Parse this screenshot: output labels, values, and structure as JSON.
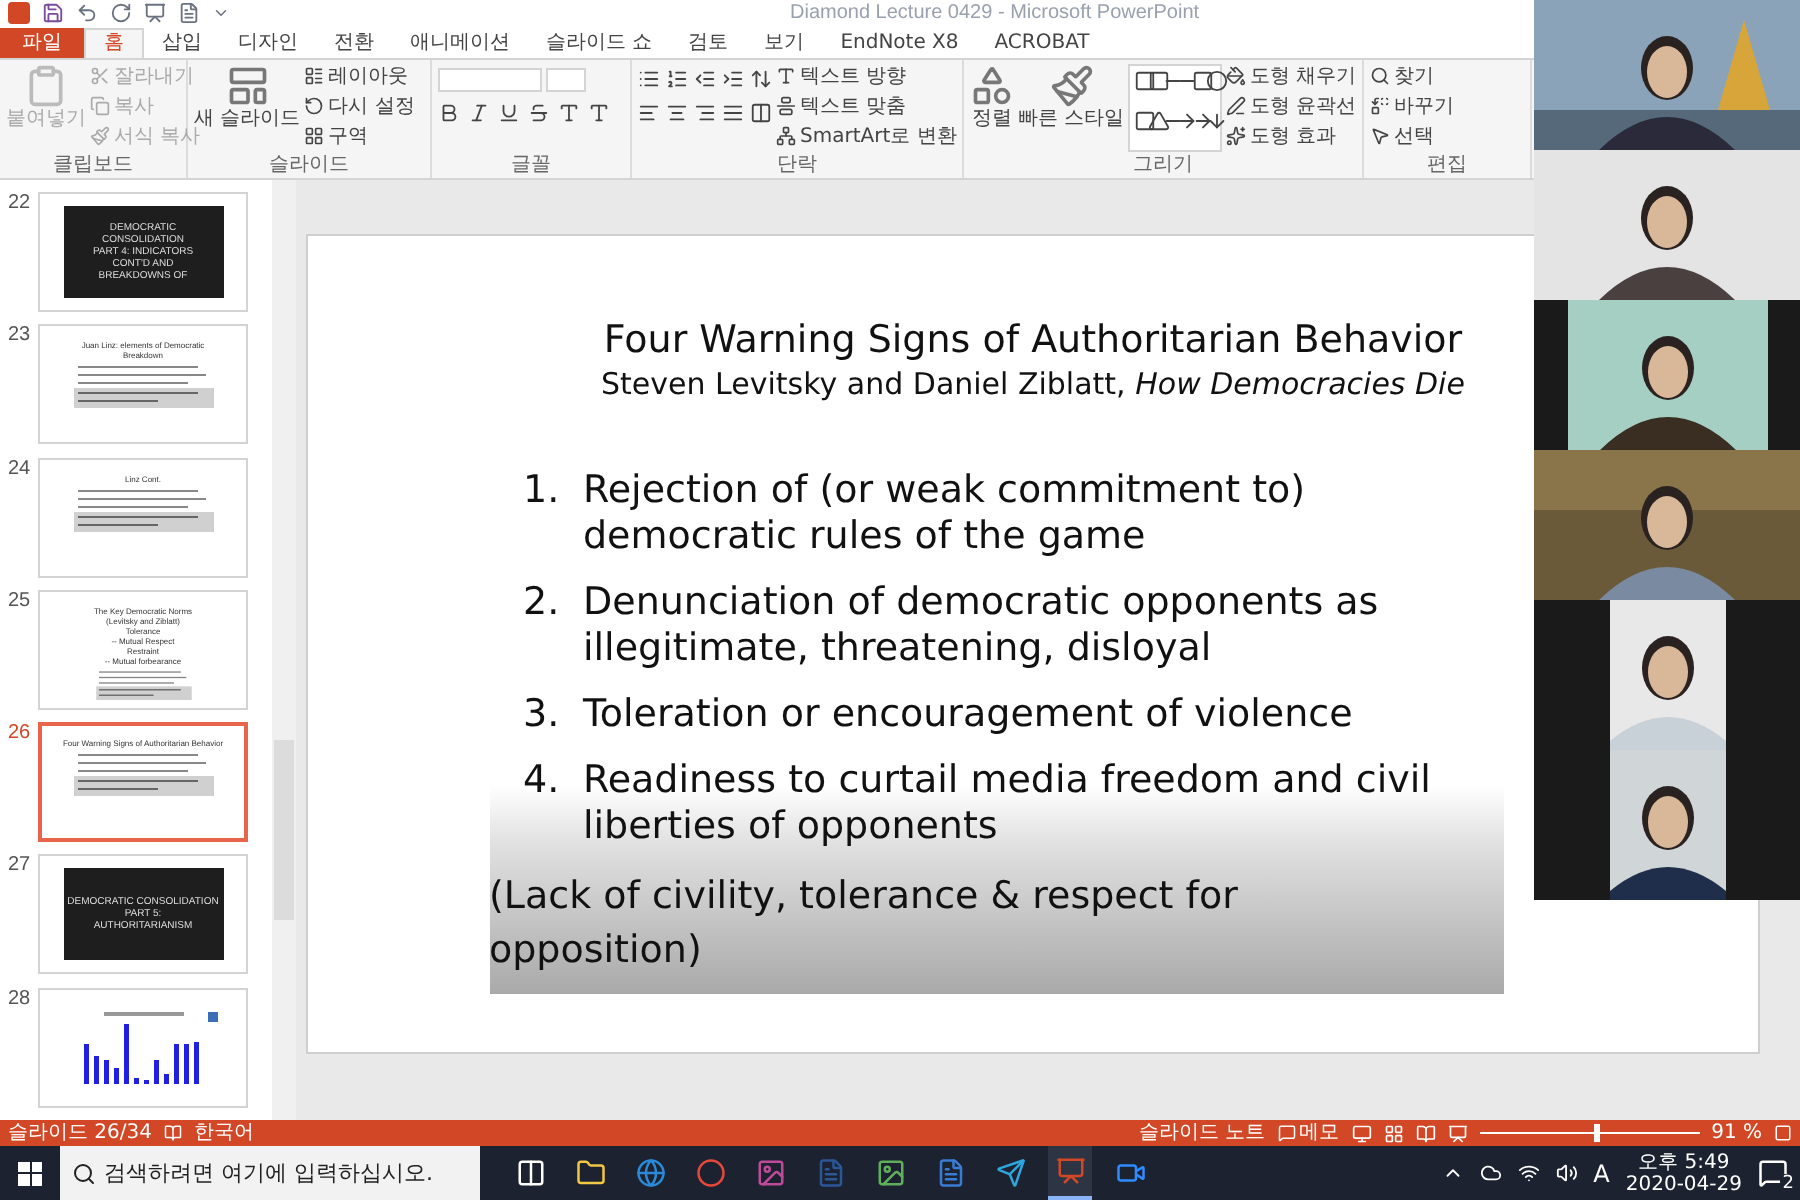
{
  "window": {
    "title": "Diamond Lecture 0429 - Microsoft PowerPoint"
  },
  "ribbon_tabs": [
    {
      "label": "파일",
      "kind": "file",
      "selected": false
    },
    {
      "label": "홈",
      "kind": "tab",
      "selected": true
    },
    {
      "label": "삽입",
      "kind": "tab",
      "selected": false
    },
    {
      "label": "디자인",
      "kind": "tab",
      "selected": false
    },
    {
      "label": "전환",
      "kind": "tab",
      "selected": false
    },
    {
      "label": "애니메이션",
      "kind": "tab",
      "selected": false
    },
    {
      "label": "슬라이드 쇼",
      "kind": "tab",
      "selected": false
    },
    {
      "label": "검토",
      "kind": "tab",
      "selected": false
    },
    {
      "label": "보기",
      "kind": "tab",
      "selected": false
    },
    {
      "label": "EndNote X8",
      "kind": "tab",
      "selected": false
    },
    {
      "label": "ACROBAT",
      "kind": "tab",
      "selected": false
    }
  ],
  "ribbon_groups": [
    {
      "label": "클립보드",
      "disabled": true,
      "large": [
        "붙여넣기"
      ],
      "small": [
        "잘라내기",
        "복사",
        "서식 복사"
      ]
    },
    {
      "label": "슬라이드",
      "disabled": false,
      "large": [
        "새 슬라이드"
      ],
      "small": [
        "레이아웃",
        "다시 설정",
        "구역"
      ]
    },
    {
      "label": "글꼴",
      "disabled": false
    },
    {
      "label": "단락",
      "disabled": false,
      "small": [
        "텍스트 방향",
        "텍스트 맞춤",
        "SmartArt로 변환"
      ]
    },
    {
      "label": "그리기",
      "disabled": false,
      "large": [
        "정렬",
        "빠른 스타일"
      ],
      "small": [
        "도형 채우기",
        "도형 윤곽선",
        "도형 효과"
      ]
    },
    {
      "label": "편집",
      "disabled": false,
      "small": [
        "찾기",
        "바꾸기",
        "선택"
      ]
    }
  ],
  "thumbnails": [
    {
      "number": "22",
      "kind": "dark",
      "selected": false,
      "lines": [
        "DEMOCRATIC",
        "CONSOLIDATION",
        "PART 4: INDICATORS",
        "CONT'D AND",
        "BREAKDOWNS OF"
      ]
    },
    {
      "number": "23",
      "kind": "text",
      "selected": false,
      "lines": [
        "Juan Linz: elements of Democratic",
        "Breakdown"
      ]
    },
    {
      "number": "24",
      "kind": "text",
      "selected": false,
      "lines": [
        "Linz Cont."
      ]
    },
    {
      "number": "25",
      "kind": "text",
      "selected": false,
      "lines": [
        "The Key Democratic Norms",
        "(Levitsky and Ziblatt)",
        "Tolerance",
        "-- Mutual Respect",
        "Restraint",
        "-- Mutual forbearance"
      ]
    },
    {
      "number": "26",
      "kind": "text",
      "selected": true,
      "lines": [
        "Four Warning Signs of Authoritarian Behavior"
      ]
    },
    {
      "number": "27",
      "kind": "dark",
      "selected": false,
      "lines": [
        "DEMOCRATIC CONSOLIDATION",
        "PART 5:",
        "AUTHORITARIANISM"
      ]
    },
    {
      "number": "28",
      "kind": "chart",
      "selected": false
    }
  ],
  "slide": {
    "title": "Four Warning Signs of Authoritarian Behavior",
    "subtitle": "Steven Levitsky and Daniel Ziblatt, *How Democracies Die*",
    "items": [
      {
        "number": "1.",
        "text": "Rejection of (or weak commitment to) democratic rules of the game"
      },
      {
        "number": "2.",
        "text": "Denunciation of democratic opponents as illegitimate, threatening, disloyal"
      },
      {
        "number": "3.",
        "text": "Toleration or encouragement of violence"
      },
      {
        "number": "4.",
        "text": "Readiness to curtail media freedom and civil liberties of opponents"
      }
    ],
    "note": "(Lack of civility, tolerance & respect for opposition)"
  },
  "video_tiles": [
    {
      "letterbox": false
    },
    {
      "letterbox": false
    },
    {
      "letterbox": true
    },
    {
      "letterbox": false
    },
    {
      "letterbox": true
    },
    {
      "letterbox": true
    }
  ],
  "status_bar": {
    "slide": "슬라이드 26/34",
    "language": "한국어",
    "notes": "슬라이드 노트",
    "comments": "메모",
    "zoom": {
      "level": 0.52,
      "reading": "91 %"
    }
  },
  "taskbar": {
    "search": {
      "placeholder": "검색하려면 여기에 입력하십시오."
    },
    "input_mode": "A",
    "time": "오후 5:49",
    "date": "2020-04-29",
    "notifications": "2"
  }
}
